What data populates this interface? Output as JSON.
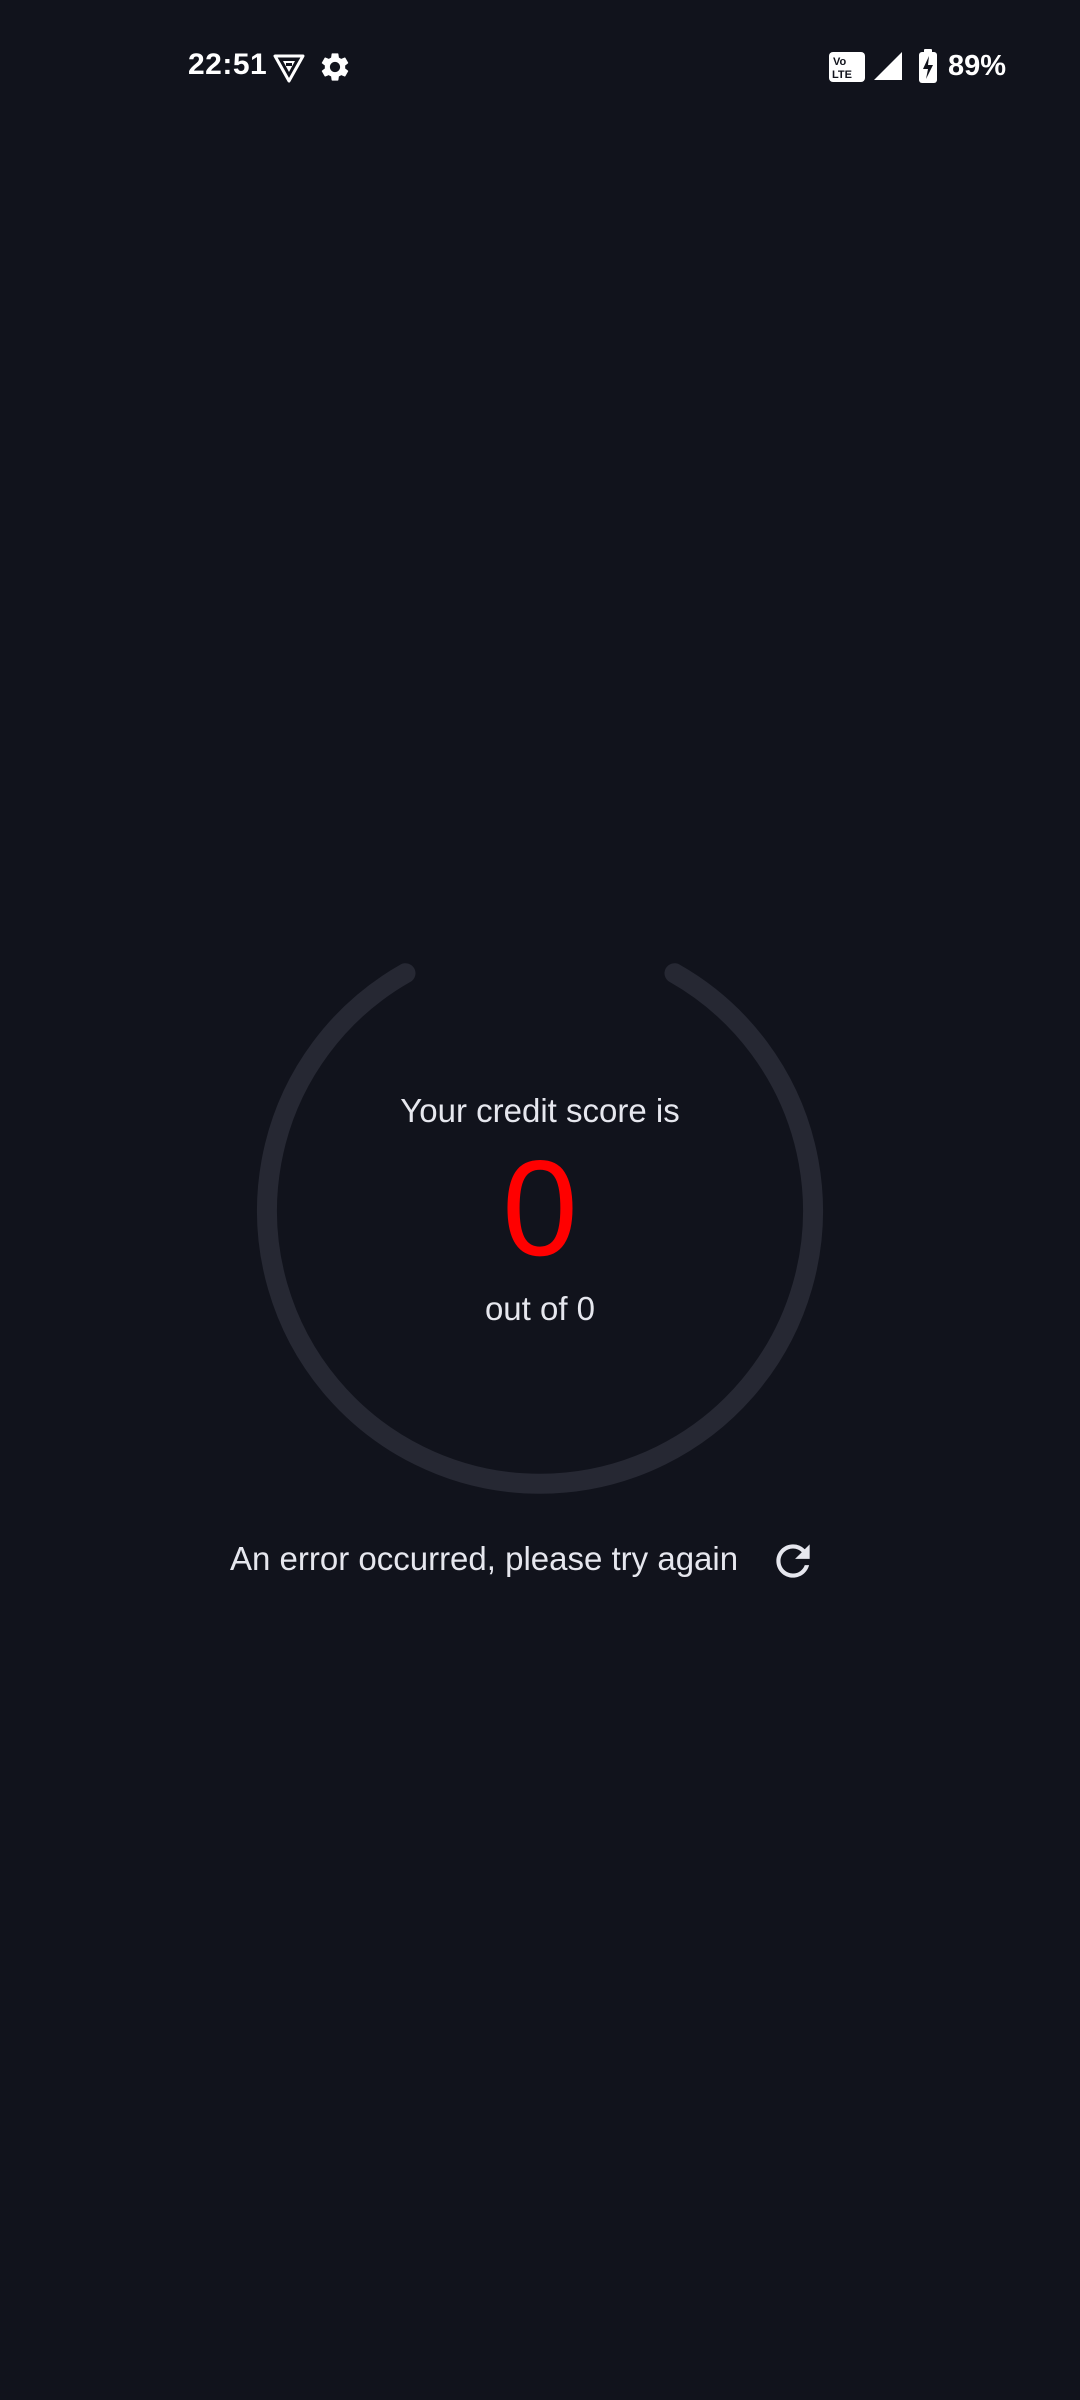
{
  "status_bar": {
    "time": "22:51",
    "battery_percent": "89%",
    "icons": [
      "vpn-shield-icon",
      "settings-gear-icon",
      "volte-icon",
      "signal-icon",
      "battery-charging-icon"
    ]
  },
  "credit_score": {
    "label": "Your credit score is",
    "score": "0",
    "out_of": "out of 0",
    "score_color": "#ff0000",
    "progress": 0
  },
  "error": {
    "message": "An error occurred, please try again",
    "retry_icon": "refresh-icon"
  },
  "colors": {
    "background": "#11131c",
    "text": "#e6e7ee",
    "gauge_track": "#262833",
    "score": "#ff0000"
  }
}
